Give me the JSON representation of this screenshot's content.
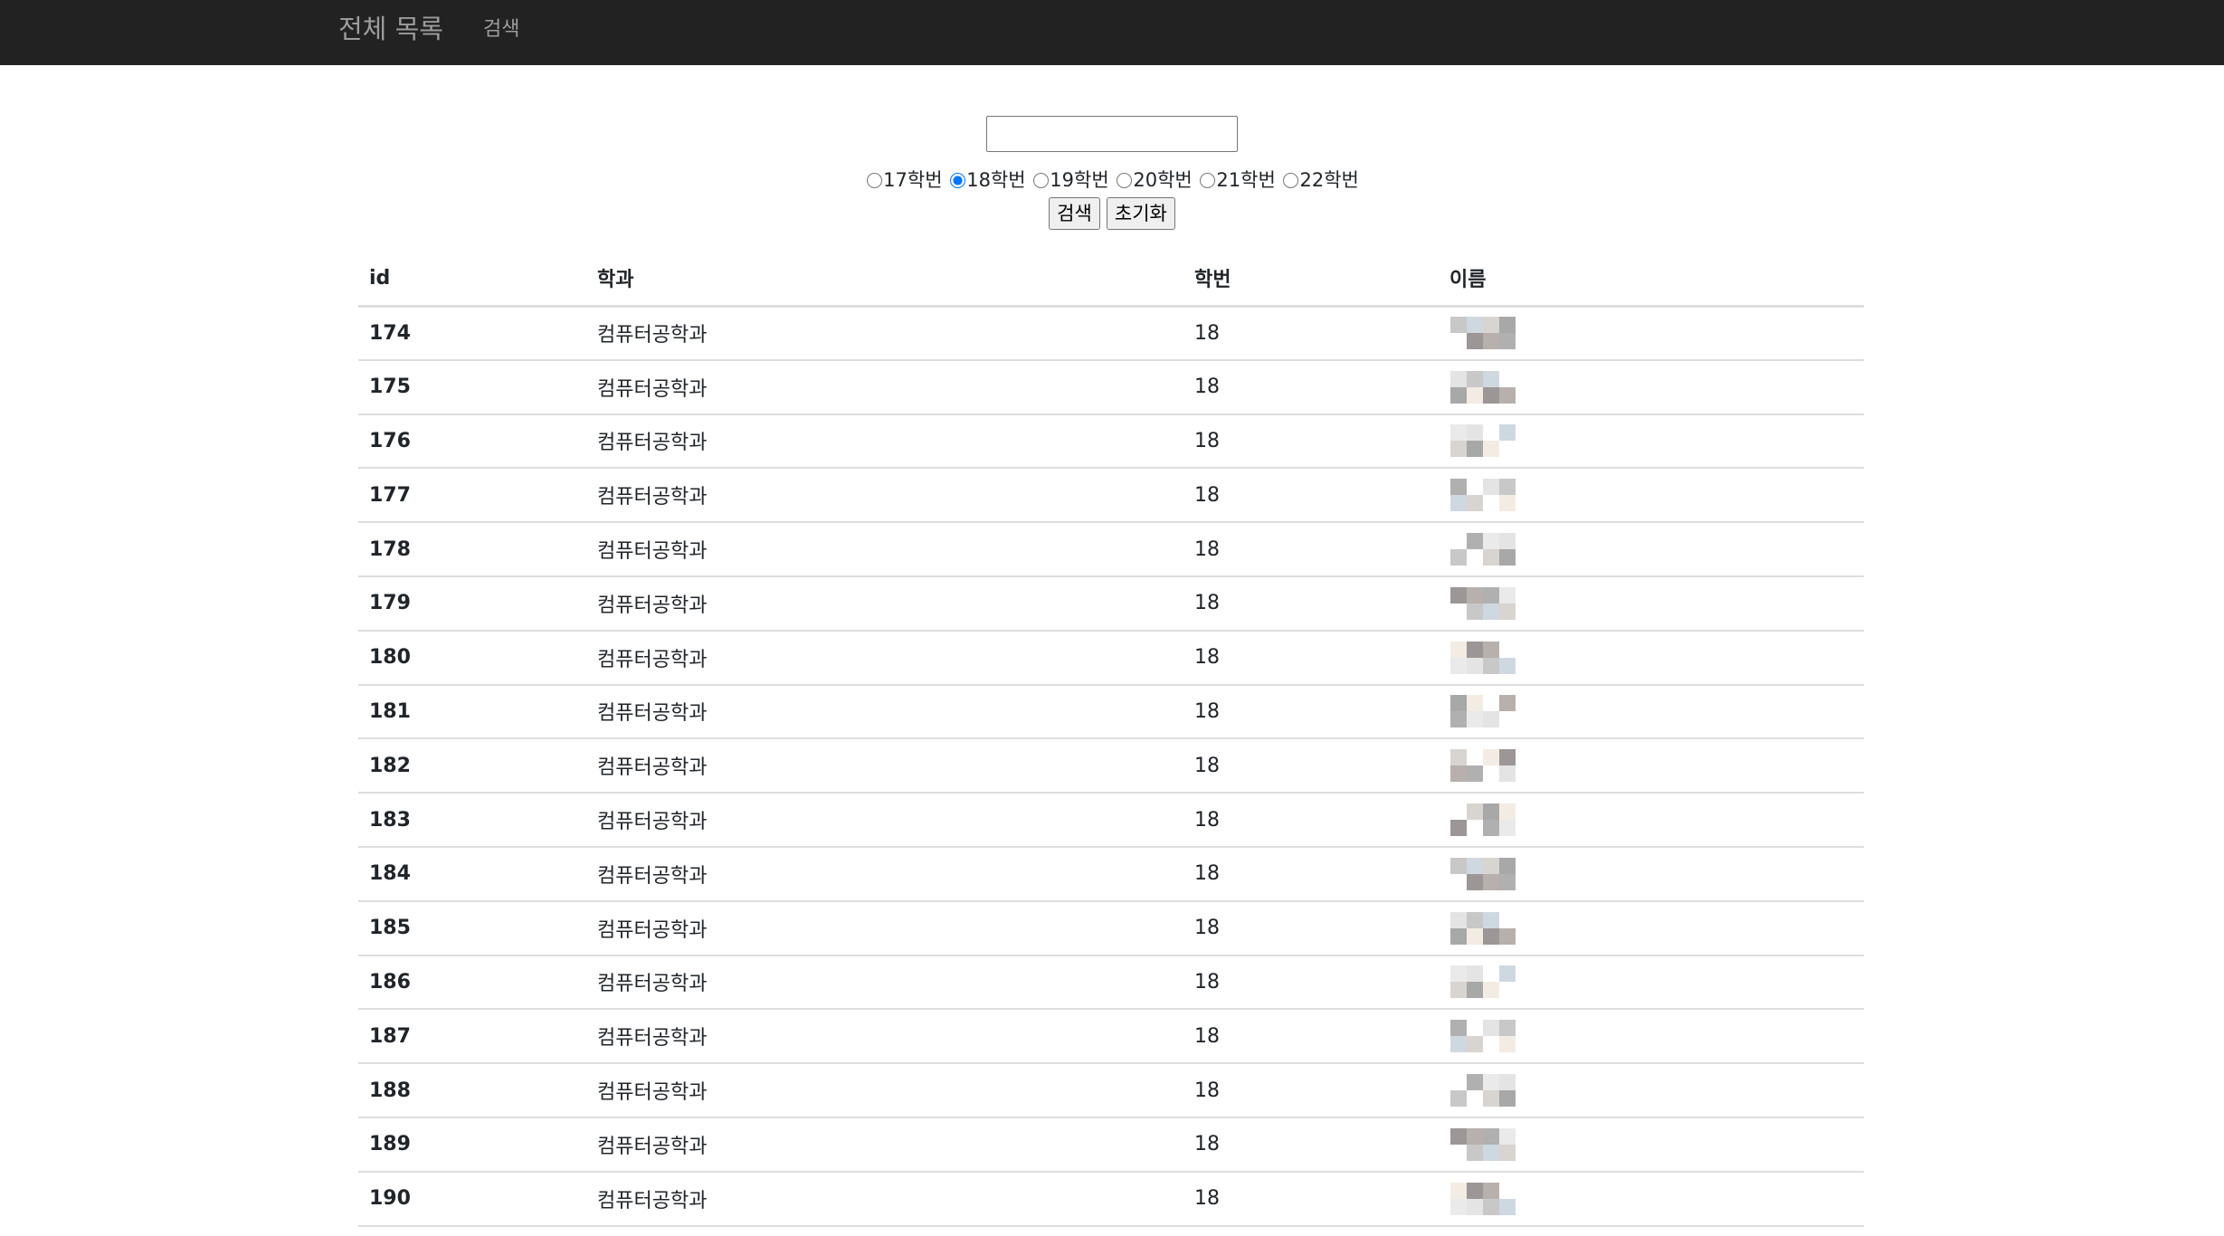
{
  "navbar": {
    "brand": "전체 목록",
    "links": [
      "검색"
    ]
  },
  "search": {
    "input_value": "",
    "radios": [
      {
        "label": "17학번",
        "checked": false
      },
      {
        "label": "18학번",
        "checked": true
      },
      {
        "label": "19학번",
        "checked": false
      },
      {
        "label": "20학번",
        "checked": false
      },
      {
        "label": "21학번",
        "checked": false
      },
      {
        "label": "22학번",
        "checked": false
      }
    ],
    "search_button": "검색",
    "reset_button": "초기화"
  },
  "table": {
    "headers": [
      "id",
      "학과",
      "학번",
      "이름"
    ],
    "rows": [
      {
        "id": "174",
        "dept": "컴퓨터공학과",
        "year": "18"
      },
      {
        "id": "175",
        "dept": "컴퓨터공학과",
        "year": "18"
      },
      {
        "id": "176",
        "dept": "컴퓨터공학과",
        "year": "18"
      },
      {
        "id": "177",
        "dept": "컴퓨터공학과",
        "year": "18"
      },
      {
        "id": "178",
        "dept": "컴퓨터공학과",
        "year": "18"
      },
      {
        "id": "179",
        "dept": "컴퓨터공학과",
        "year": "18"
      },
      {
        "id": "180",
        "dept": "컴퓨터공학과",
        "year": "18"
      },
      {
        "id": "181",
        "dept": "컴퓨터공학과",
        "year": "18"
      },
      {
        "id": "182",
        "dept": "컴퓨터공학과",
        "year": "18"
      },
      {
        "id": "183",
        "dept": "컴퓨터공학과",
        "year": "18"
      },
      {
        "id": "184",
        "dept": "컴퓨터공학과",
        "year": "18"
      },
      {
        "id": "185",
        "dept": "컴퓨터공학과",
        "year": "18"
      },
      {
        "id": "186",
        "dept": "컴퓨터공학과",
        "year": "18"
      },
      {
        "id": "187",
        "dept": "컴퓨터공학과",
        "year": "18"
      },
      {
        "id": "188",
        "dept": "컴퓨터공학과",
        "year": "18"
      },
      {
        "id": "189",
        "dept": "컴퓨터공학과",
        "year": "18"
      },
      {
        "id": "190",
        "dept": "컴퓨터공학과",
        "year": "18"
      }
    ]
  },
  "colors": {
    "navbar_bg": "#222222",
    "navbar_text": "#9d9d9d",
    "row_border": "#dddddd"
  }
}
